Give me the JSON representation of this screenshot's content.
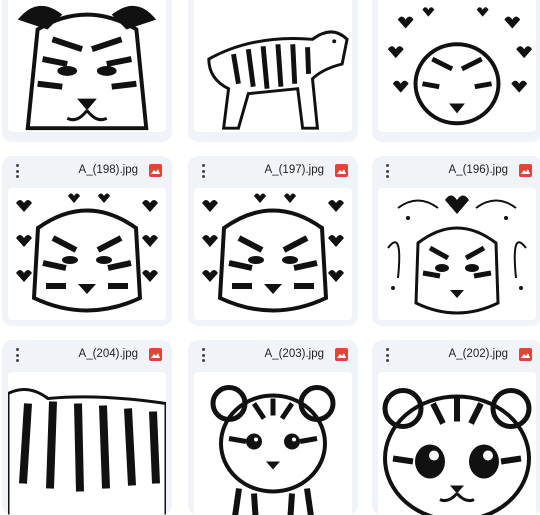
{
  "files": [
    {
      "name": "",
      "type_icon": "image-icon"
    },
    {
      "name": "",
      "type_icon": "image-icon"
    },
    {
      "name": "",
      "type_icon": "image-icon"
    },
    {
      "name": "A_(198).jpg",
      "type_icon": "image-icon"
    },
    {
      "name": "A_(197).jpg",
      "type_icon": "image-icon"
    },
    {
      "name": "A_(196).jpg",
      "type_icon": "image-icon"
    },
    {
      "name": "A_(204).jpg",
      "type_icon": "image-icon"
    },
    {
      "name": "A_(203).jpg",
      "type_icon": "image-icon"
    },
    {
      "name": "A_(202).jpg",
      "type_icon": "image-icon"
    }
  ],
  "colors": {
    "card_bg": "#f0f4f9",
    "image_icon": "#e94235",
    "text": "#1f1f1f"
  }
}
